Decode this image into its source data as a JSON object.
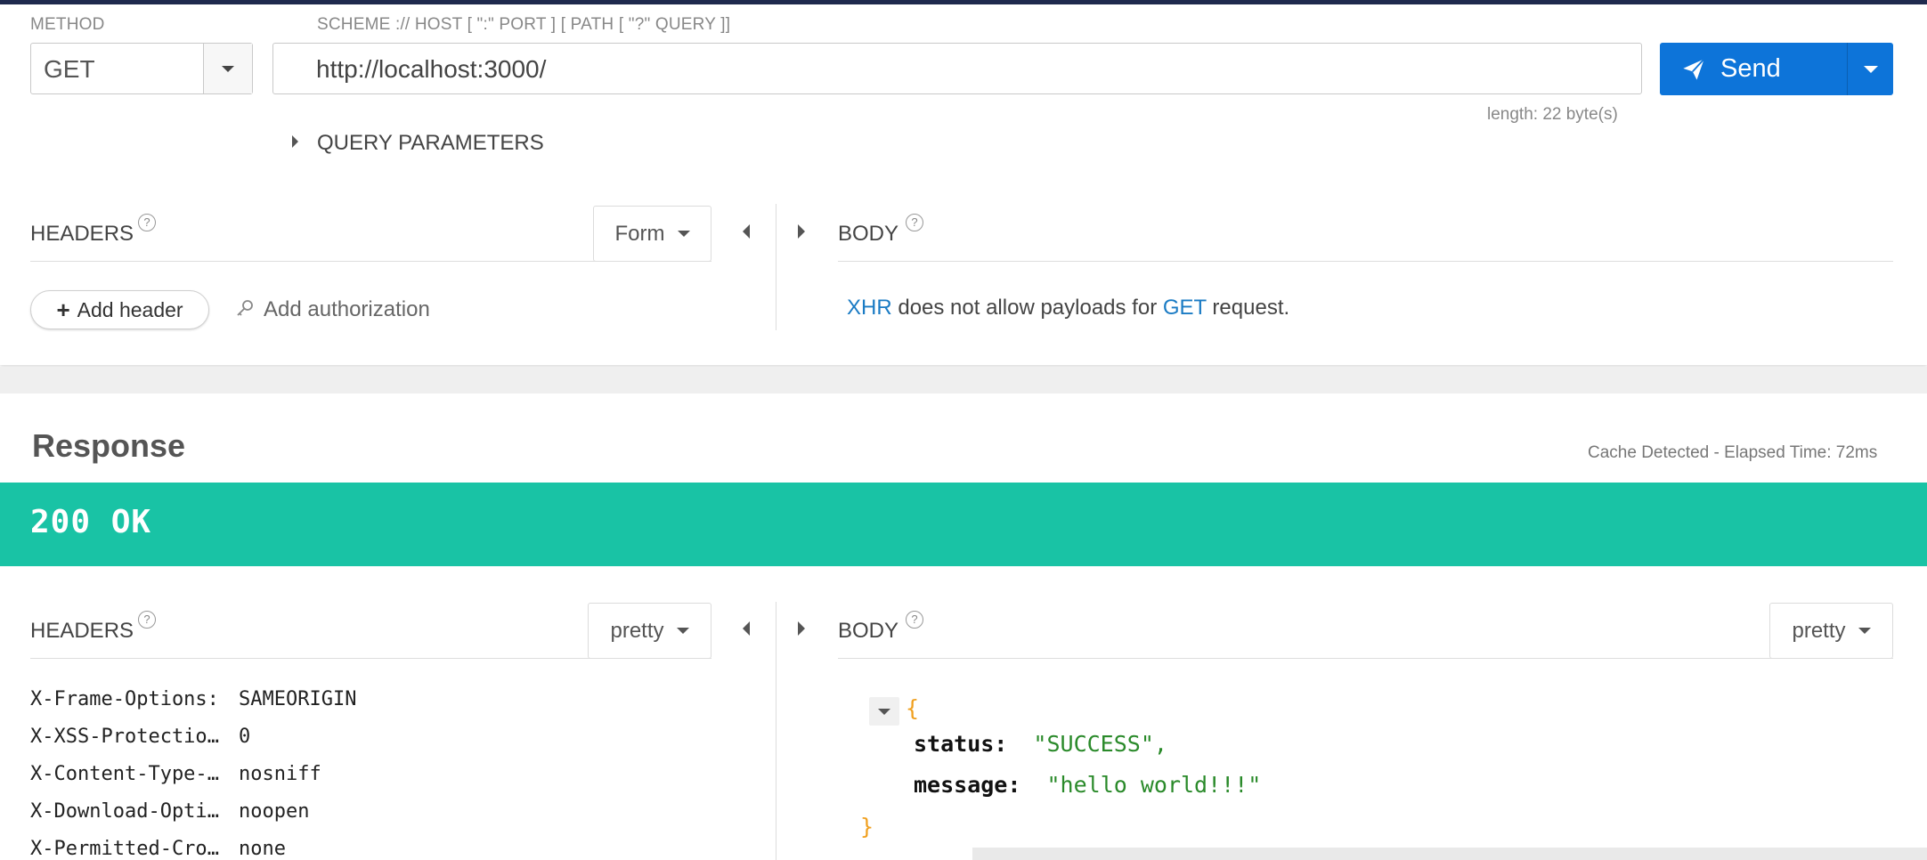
{
  "request": {
    "method_label": "METHOD",
    "method_value": "GET",
    "url_label": "SCHEME :// HOST [ \":\" PORT ] [ PATH [ \"?\" QUERY ]]",
    "url_value": "http://localhost:3000/",
    "send_label": "Send",
    "length_text": "length: 22 byte(s)",
    "query_params_label": "QUERY PARAMETERS",
    "headers_title": "HEADERS",
    "headers_format": "Form",
    "add_header_label": "Add header",
    "add_auth_label": "Add authorization",
    "body_title": "BODY",
    "body_msg_xhr": "XHR",
    "body_msg_mid": " does not allow payloads for ",
    "body_msg_get": "GET",
    "body_msg_end": " request."
  },
  "response": {
    "title": "Response",
    "cache_text": "Cache Detected - Elapsed Time: 72ms",
    "status_text": "200 OK",
    "status_color": "#19c3a5",
    "headers_title": "HEADERS",
    "headers_format": "pretty",
    "body_title": "BODY",
    "body_format": "pretty",
    "headers": [
      {
        "key": "X-Frame-Options:",
        "value": "SAMEORIGIN"
      },
      {
        "key": "X-XSS-Protection:",
        "value": "0"
      },
      {
        "key": "X-Content-Type-O…",
        "value": "nosniff"
      },
      {
        "key": "X-Download-Optio…",
        "value": "noopen"
      },
      {
        "key": "X-Permitted-Cros…",
        "value": "none"
      }
    ],
    "json": {
      "open": "{",
      "close": "}",
      "status_key": "status:",
      "status_val": "\"SUCCESS\",",
      "message_key": "message:",
      "message_val": "\"hello world!!!\""
    }
  },
  "colors": {
    "accent": "#0d74d9",
    "link": "#1a7bc4"
  },
  "icons": {
    "send": "paper-plane-icon",
    "help": "question-circle-icon",
    "plus": "plus-icon",
    "key": "key-icon"
  }
}
